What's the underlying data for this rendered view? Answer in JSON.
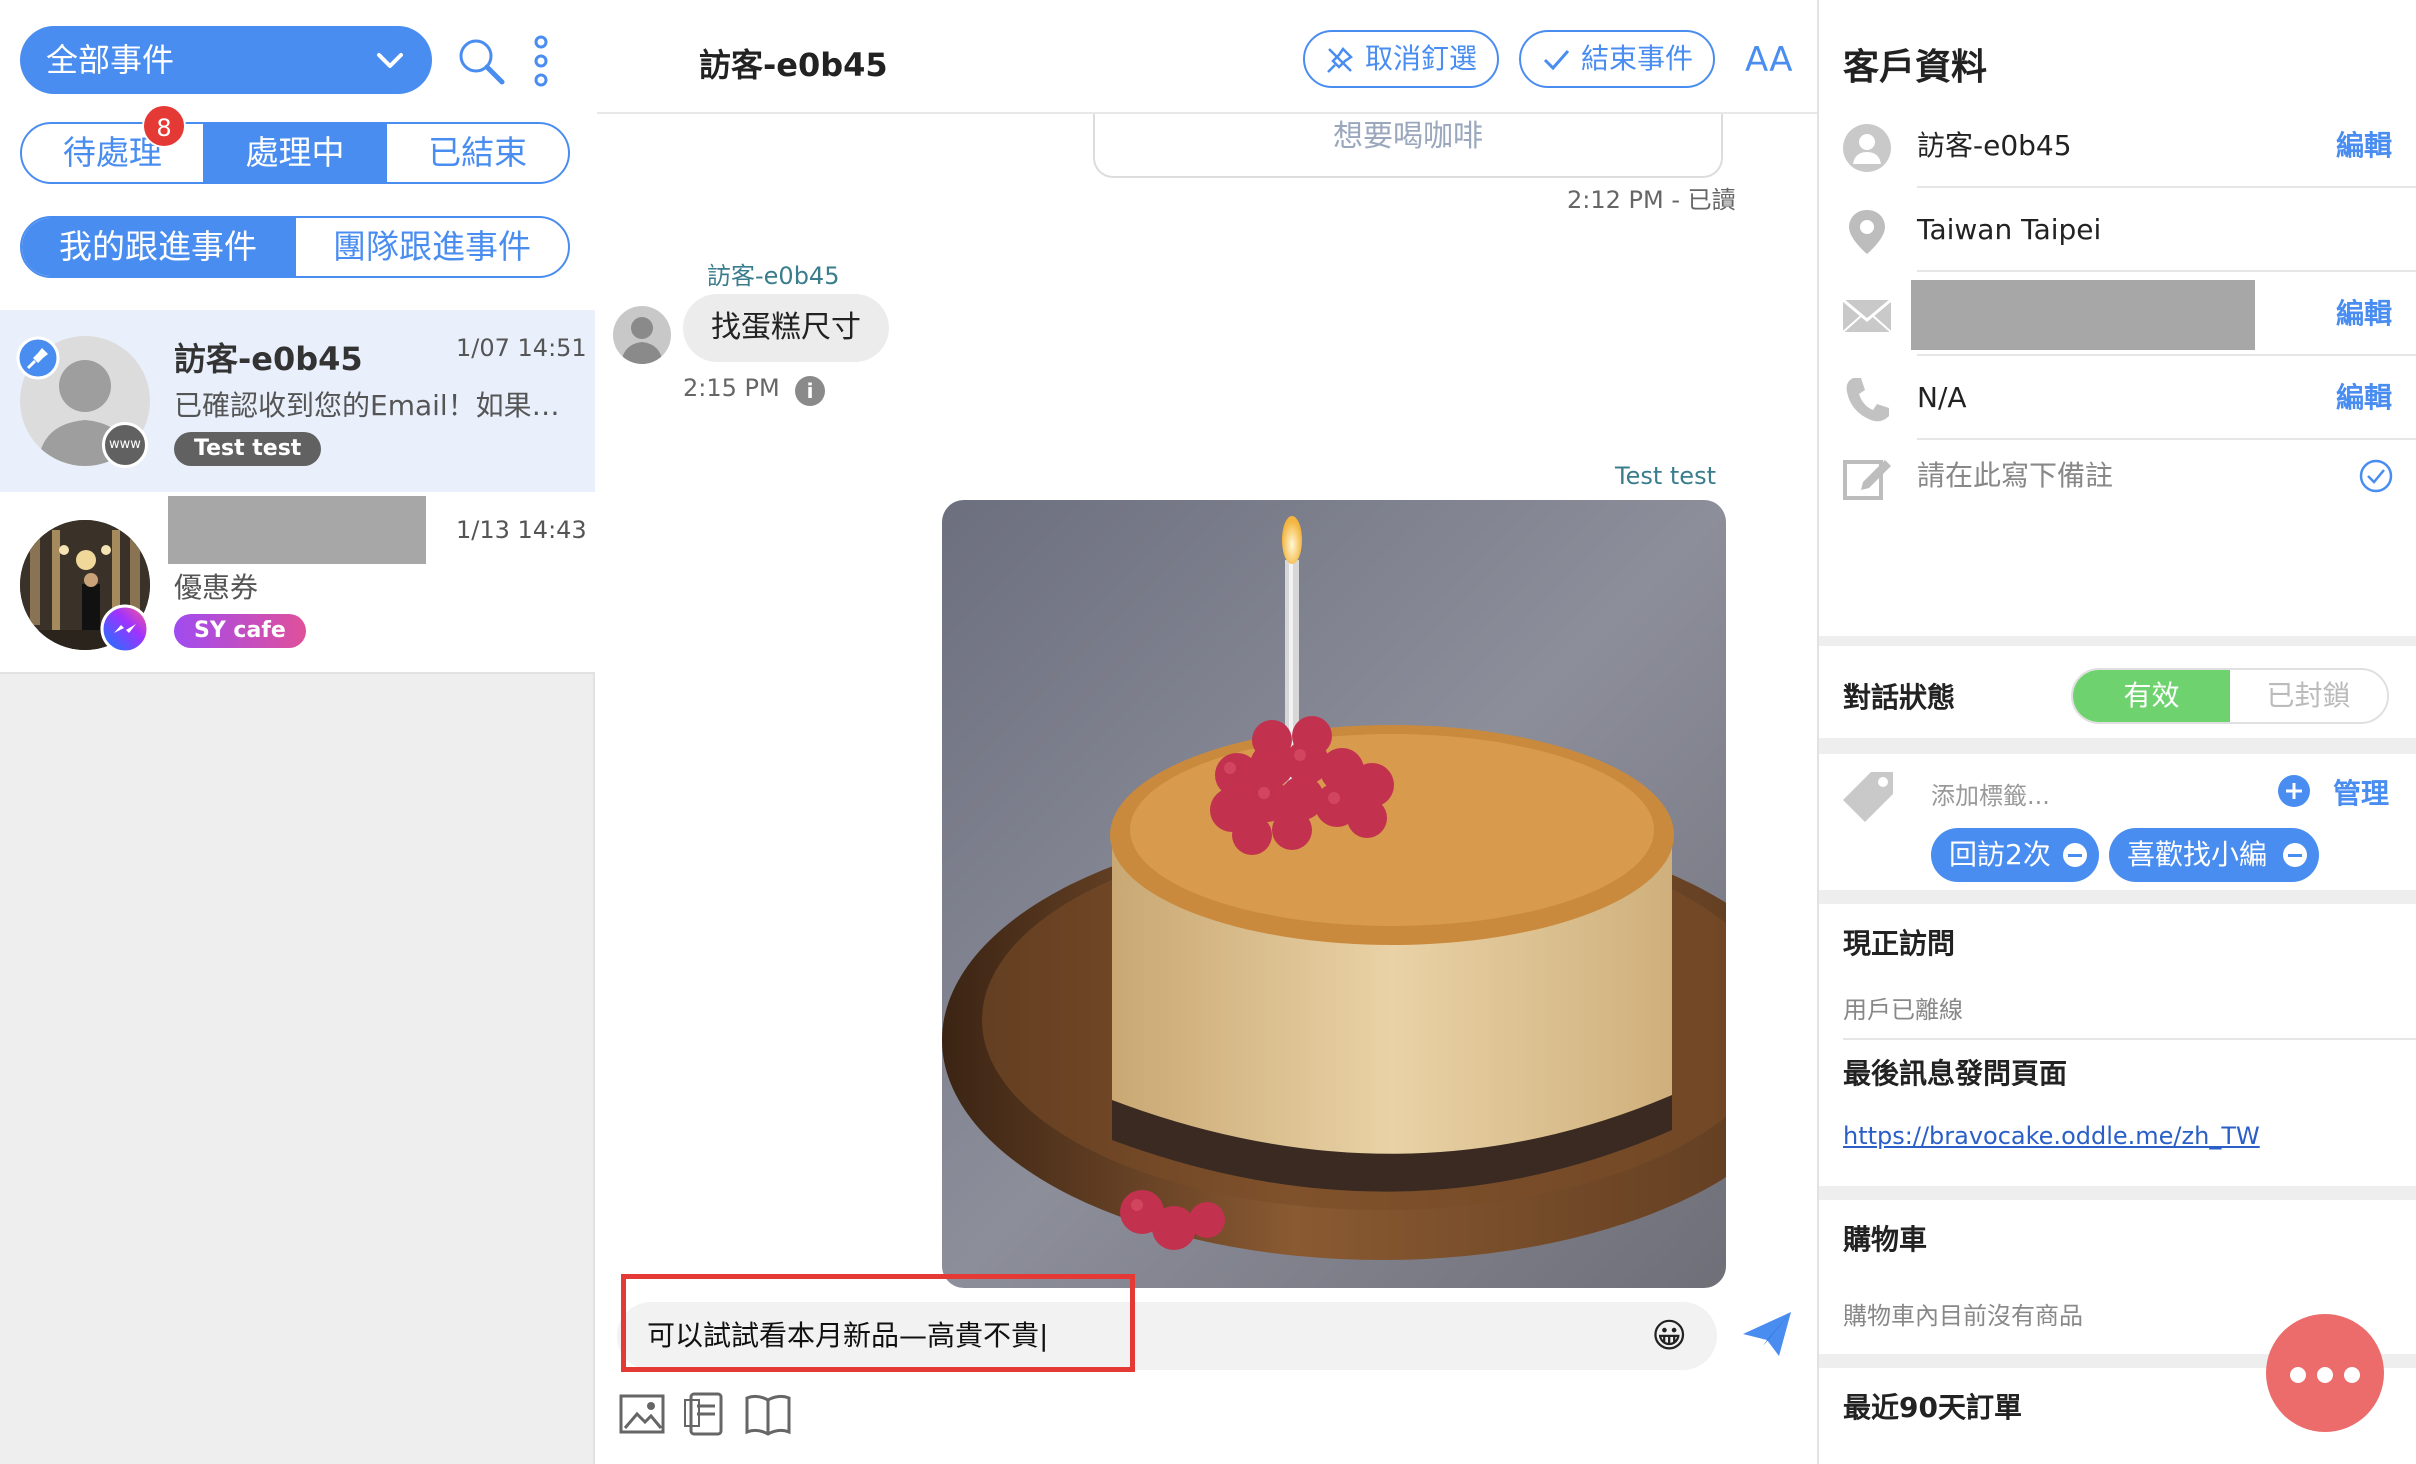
{
  "inbox": {
    "filter_label": "全部事件",
    "status_tabs": [
      {
        "label": "待處理",
        "badge": "8"
      },
      {
        "label": "處理中",
        "active": true
      },
      {
        "label": "已結束"
      }
    ],
    "follow_tabs": [
      {
        "label": "我的跟進事件",
        "active": true
      },
      {
        "label": "團隊跟進事件"
      }
    ],
    "conversations": [
      {
        "name": "訪客-e0b45",
        "time": "1/07 14:51",
        "preview": "已確認收到您的Email！如果…",
        "tag": "Test test",
        "channel": "www",
        "pinned": true
      },
      {
        "name": "",
        "time": "1/13 14:43",
        "preview": "優惠券",
        "tag": "SY cafe",
        "channel": "messenger"
      }
    ]
  },
  "chat": {
    "title": "訪客-e0b45",
    "unpin_label": "取消釘選",
    "close_label": "結束事件",
    "font_size_label": "AA",
    "messages": {
      "prev_bubble_text": "想要喝咖啡",
      "prev_status": "2:12 PM - 已讀",
      "visitor_name": "訪客-e0b45",
      "visitor_text": "找蛋糕尺寸",
      "visitor_time": "2:15 PM",
      "agent_name": "Test test"
    },
    "compose_text": "可以試試看本月新品—高貴不貴|",
    "emoji": "😀"
  },
  "profile": {
    "title": "客戶資料",
    "name": "訪客-e0b45",
    "location": "Taiwan Taipei",
    "phone": "N/A",
    "note_placeholder": "請在此寫下備註",
    "edit_label": "編輯",
    "conversation_status_label": "對話狀態",
    "status_active": "有效",
    "status_blocked": "已封鎖",
    "tag_placeholder": "添加標籤...",
    "manage_label": "管理",
    "tags": [
      "回訪2次",
      "喜歡找小編"
    ],
    "visit_title": "現正訪問",
    "visit_status": "用戶已離線",
    "last_page_title": "最後訊息發問頁面",
    "last_page_url": "https://bravocake.oddle.me/zh_TW",
    "cart_title": "購物車",
    "cart_empty": "購物車內目前沒有商品",
    "orders_title": "最近90天訂單"
  },
  "colors": {
    "accent": "#4a8df0",
    "badge": "#e53935",
    "active_green": "#6ed36f",
    "fab": "#ec6b6b"
  }
}
